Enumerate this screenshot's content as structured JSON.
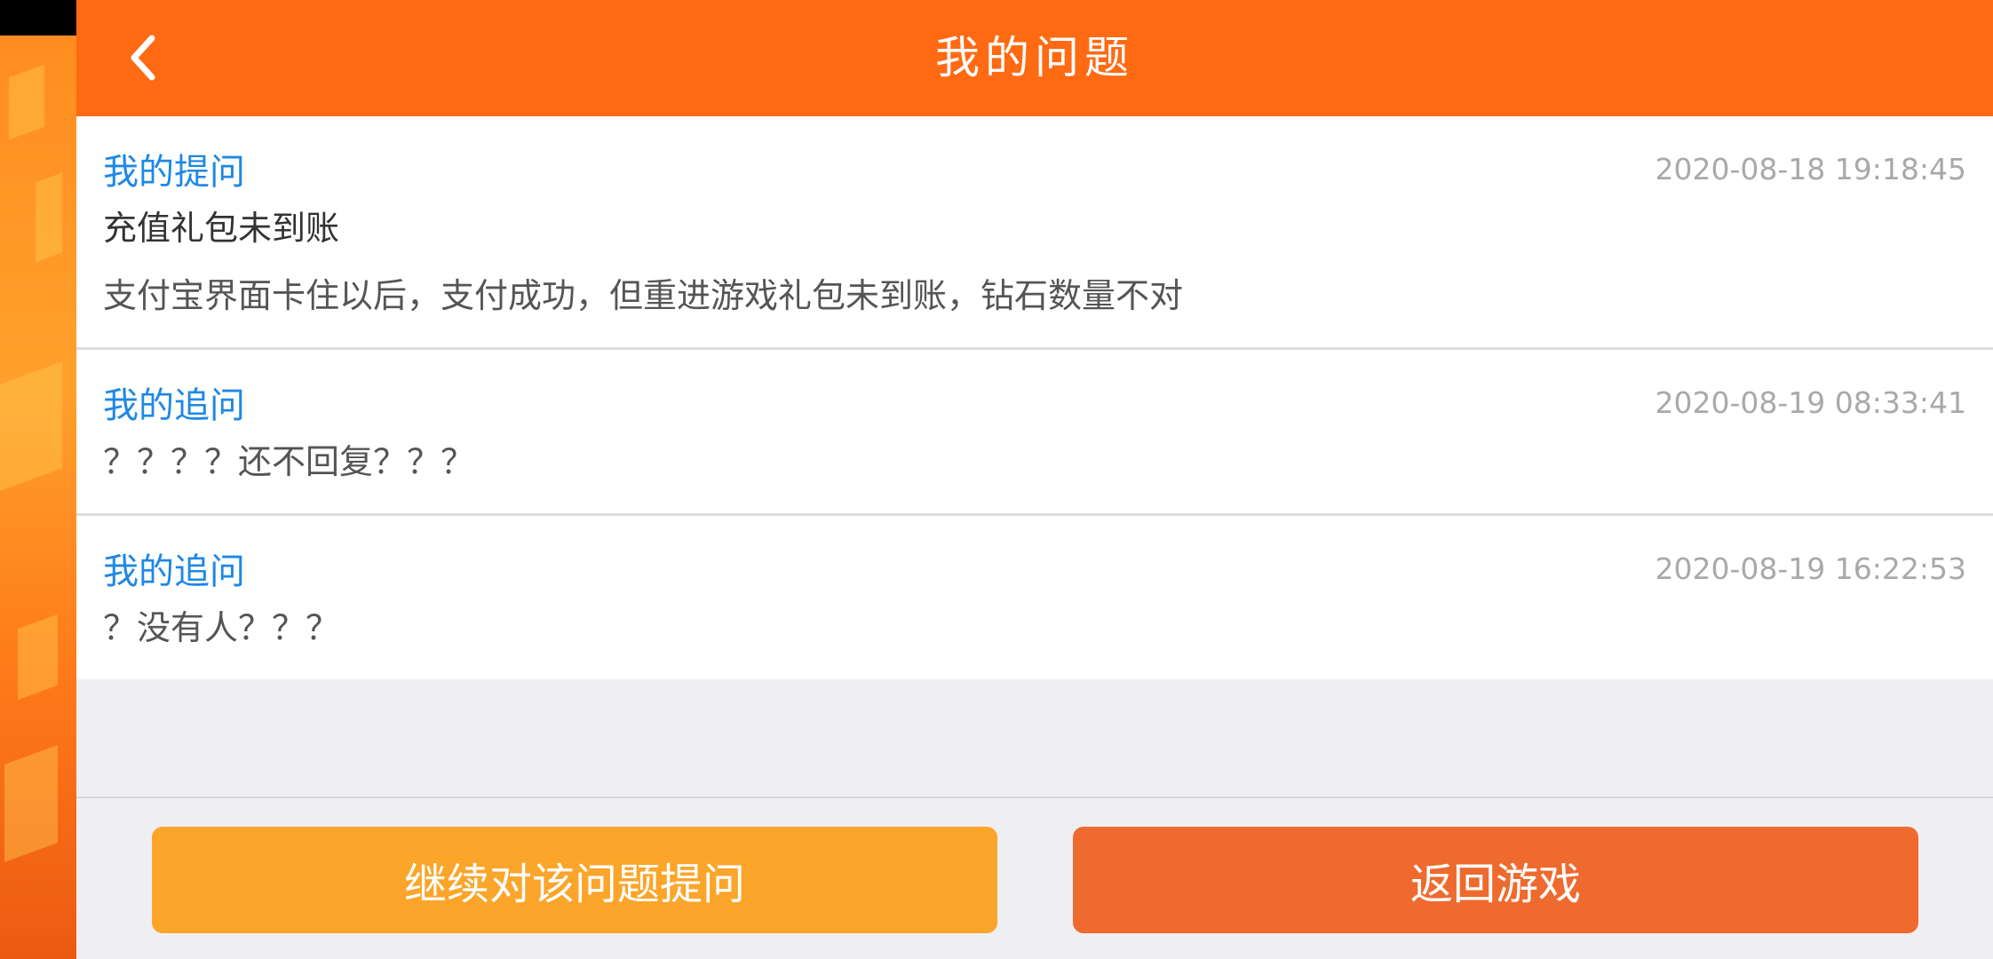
{
  "header": {
    "title": "我的问题",
    "back_icon": "chevron-left-icon",
    "color": "#ff6a13"
  },
  "entries": [
    {
      "label": "我的提问",
      "time": "2020-08-18 19:18:45",
      "title": "充值礼包未到账",
      "body": "支付宝界面卡住以后，支付成功，但重进游戏礼包未到账，钻石数量不对"
    },
    {
      "label": "我的追问",
      "time": "2020-08-19 08:33:41",
      "body": "？？？？还不回复？？？"
    },
    {
      "label": "我的追问",
      "time": "2020-08-19 16:22:53",
      "body": "？没有人？？？"
    }
  ],
  "footer": {
    "continue_label": "继续对该问题提问",
    "return_label": "返回游戏",
    "continue_color": "#fba52a",
    "return_color": "#ee6a2e"
  },
  "colors": {
    "accent_blue": "#1e88e5",
    "timestamp_gray": "#a9a9a9"
  }
}
